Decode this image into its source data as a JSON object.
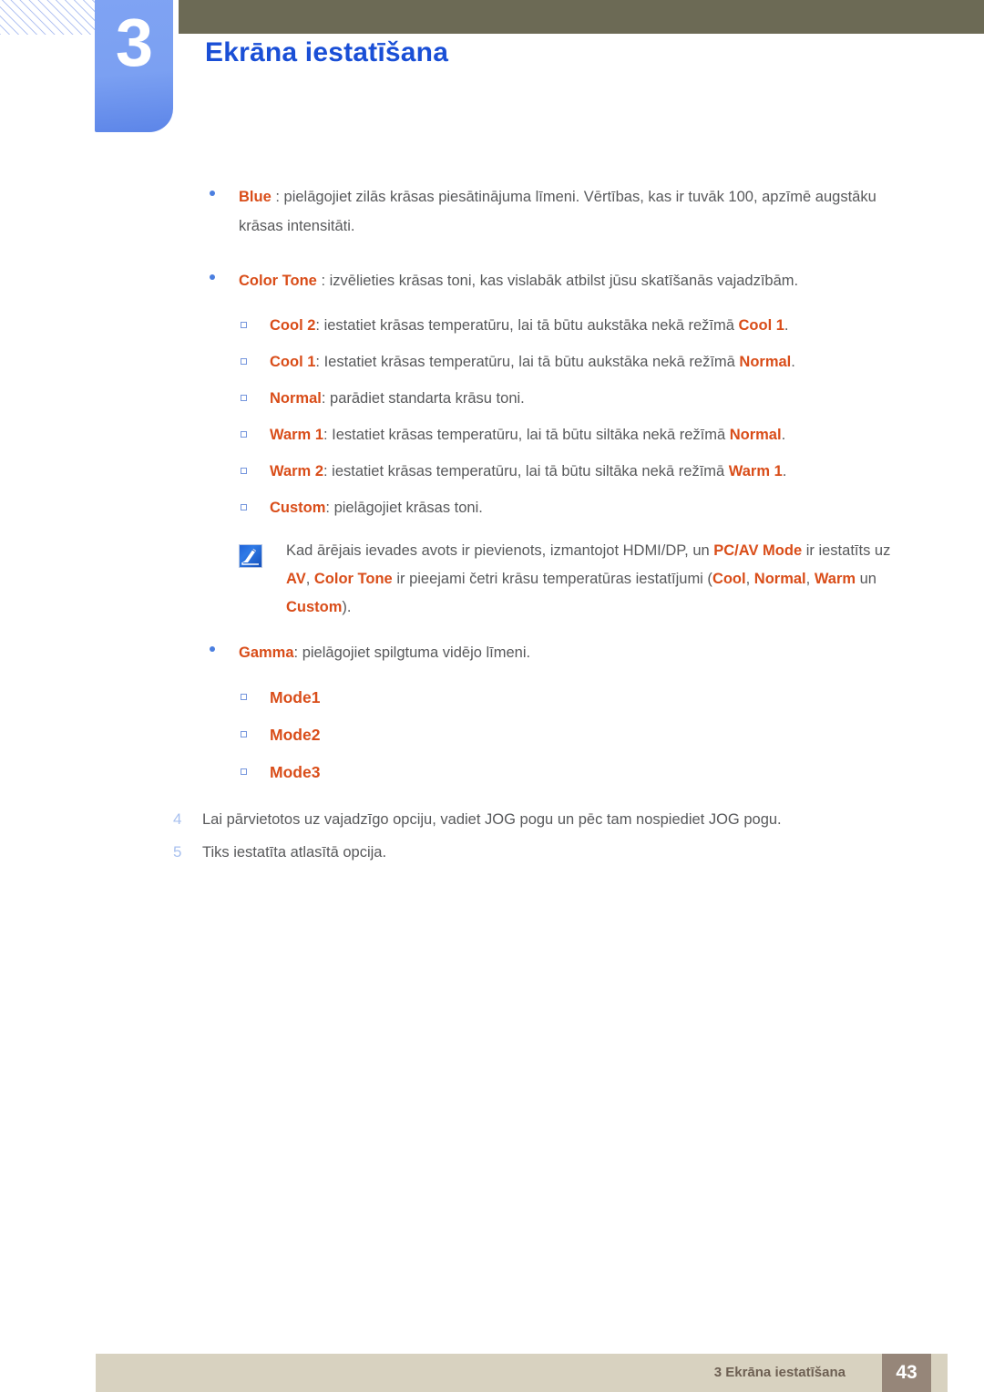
{
  "header": {
    "chapter_number": "3",
    "chapter_title": "Ekrāna iestatīšana"
  },
  "content": {
    "blue_item": {
      "term": "Blue",
      "sep": " : ",
      "text": "pielāgojiet zilās krāsas piesātinājuma līmeni. Vērtības, kas ir tuvāk 100, apzīmē augstāku krāsas intensitāti."
    },
    "color_tone_item": {
      "term": "Color Tone",
      "sep": " : ",
      "text": "izvēlieties krāsas toni, kas vislabāk atbilst jūsu skatīšanās vajadzībām."
    },
    "color_tone_options": [
      {
        "term": "Cool 2",
        "sep": ": ",
        "text_before": "iestatiet krāsas temperatūru, lai tā būtu aukstāka nekā režīmā ",
        "ref": "Cool 1",
        "text_after": "."
      },
      {
        "term": "Cool 1",
        "sep": ": ",
        "text_before": "Iestatiet krāsas temperatūru, lai tā būtu aukstāka nekā režīmā ",
        "ref": "Normal",
        "text_after": "."
      },
      {
        "term": "Normal",
        "sep": ": ",
        "text_before": "parādiet standarta krāsu toni.",
        "ref": "",
        "text_after": ""
      },
      {
        "term": "Warm 1",
        "sep": ": ",
        "text_before": "Iestatiet krāsas temperatūru, lai tā būtu siltāka nekā režīmā ",
        "ref": "Normal",
        "text_after": "."
      },
      {
        "term": "Warm 2",
        "sep": ": ",
        "text_before": "iestatiet krāsas temperatūru, lai tā būtu siltāka nekā režīmā ",
        "ref": "Warm 1",
        "text_after": "."
      },
      {
        "term": "Custom",
        "sep": ": ",
        "text_before": "pielāgojiet krāsas toni.",
        "ref": "",
        "text_after": ""
      }
    ],
    "note": {
      "icon_name": "note-pen-icon",
      "p1": "Kad ārējais ievades avots ir pievienots, izmantojot HDMI/DP, un ",
      "h1": "PC/AV Mode",
      "p2": " ir iestatīts uz ",
      "h2": "AV",
      "p3": ", ",
      "h3": "Color Tone",
      "p4": " ir pieejami četri krāsu temperatūras iestatījumi (",
      "h4": "Cool",
      "p5": ", ",
      "h5": "Normal",
      "p6": ", ",
      "h6": "Warm",
      "p7": " un ",
      "h7": "Custom",
      "p8": ")."
    },
    "gamma_item": {
      "term": "Gamma",
      "sep": ": ",
      "text": "pielāgojiet spilgtuma vidējo līmeni."
    },
    "gamma_modes": [
      "Mode1",
      "Mode2",
      "Mode3"
    ],
    "steps": [
      {
        "number": "4",
        "text": "Lai pārvietotos uz vajadzīgo opciju, vadiet JOG pogu un pēc tam nospiediet JOG pogu."
      },
      {
        "number": "5",
        "text": "Tiks iestatīta atlasītā opcija."
      }
    ]
  },
  "footer": {
    "label": "3 Ekrāna iestatīšana",
    "page_number": "43"
  },
  "colors": {
    "accent_orange": "#d94d19",
    "title_blue": "#1a4fd6",
    "tab_blue": "#7ba0f2",
    "olive": "#6c6a55",
    "footer_beige": "#d8d2c0",
    "footer_brown": "#968679",
    "body_gray": "#58595b"
  }
}
